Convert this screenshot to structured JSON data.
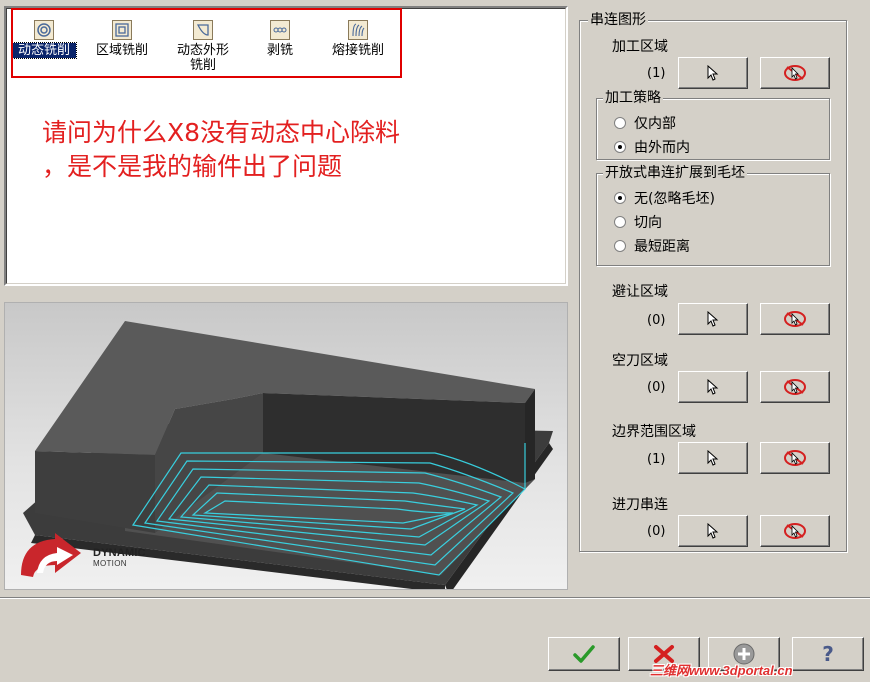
{
  "toolpath_types": [
    {
      "label": "动态铣削",
      "selected": true,
      "icon": "dynamic-mill-icon"
    },
    {
      "label": "区域铣削",
      "selected": false,
      "icon": "area-mill-icon"
    },
    {
      "label": "动态外形铣削",
      "selected": false,
      "icon": "dynamic-contour-icon"
    },
    {
      "label": "剥铣",
      "selected": false,
      "icon": "peel-mill-icon"
    },
    {
      "label": "熔接铣削",
      "selected": false,
      "icon": "blend-mill-icon"
    }
  ],
  "question": {
    "line1": "请问为什么X8没有动态中心除料",
    "line2": "，是不是我的输件出了问题"
  },
  "brand": {
    "line1": "DYNAMIC",
    "line2": "MOTION"
  },
  "chain_group": {
    "title": "串连图形",
    "machining_region": {
      "label": "加工区域",
      "count": "(1)"
    },
    "strategy": {
      "title": "加工策略",
      "options": [
        {
          "label": "仅内部",
          "checked": false
        },
        {
          "label": "由外而内",
          "checked": true
        }
      ]
    },
    "open_chain": {
      "title": "开放式串连扩展到毛坯",
      "options": [
        {
          "label": "无(忽略毛坯)",
          "checked": true
        },
        {
          "label": "切向",
          "checked": false
        },
        {
          "label": "最短距离",
          "checked": false
        }
      ]
    },
    "avoid_region": {
      "label": "避让区域",
      "count": "(0)"
    },
    "air_region": {
      "label": "空刀区域",
      "count": "(0)"
    },
    "containment_region": {
      "label": "边界范围区域",
      "count": "(1)"
    },
    "entry_chain": {
      "label": "进刀串连",
      "count": "(0)"
    }
  },
  "watermark": "三维网www.3dportal.cn",
  "colors": {
    "accent_red": "#e32020",
    "toolpath": "#38d6e6",
    "check_green": "#2a9a2a"
  }
}
